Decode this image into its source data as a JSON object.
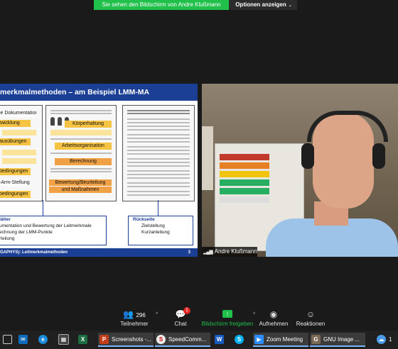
{
  "share_banner": {
    "message": "Sie sehen den Bildschirm von Andre Klußmann",
    "options_label": "Optionen anzeigen",
    "options_chevron": "⌄"
  },
  "slide": {
    "title": "merkmalmethoden – am Beispiel LMM-MA",
    "labels": {
      "dokumentation": "ie Dokumentation",
      "entwicklung": "twicklung",
      "koerperhaltung": "Körperhaltung",
      "ausuebungen": "ausübungen",
      "arbeitsorganisation": "Arbeitsorganisation",
      "berechnung": "Berechnung",
      "bedingungen": "bedingungen",
      "arm_stellung": "-Arm-Stellung",
      "bewertung": "Bewertung/Beurteilung",
      "massnahmen": "und Maßnahmen",
      "bedingungen2": "bedingungen"
    },
    "left_box": {
      "heading": "lätter",
      "lines": [
        "umentation und Bewertung der Leitmerkmale",
        "echnung der LMM-Punkte",
        "rteilung"
      ]
    },
    "right_box": {
      "heading": "Rückseite",
      "lines": [
        "Zielstellung",
        "Kurzanleitung"
      ]
    },
    "footer_text": "GAPHYS): Leitmerkmalmethoden",
    "page_number": "3"
  },
  "video": {
    "participant_name": "Andre Klußmann"
  },
  "toolbar": {
    "participants_label": "Teilnehmer",
    "participants_count": "296",
    "chat_label": "Chat",
    "chat_badge": "1",
    "share_label": "Bildschirm freigeben",
    "record_label": "Aufnehmen",
    "reactions_label": "Reaktionen"
  },
  "taskbar": {
    "powerpoint_label": "Screenshots -...",
    "speedcomm_label": "SpeedComm...",
    "zoom_label": "Zoom Meeting",
    "gimp_label": "GNU Image ...",
    "tray_text": "1"
  },
  "colors": {
    "banner_green": "#20c04a",
    "slide_blue": "#1b3f94",
    "label_yellow": "#f6c343",
    "label_orange": "#f0a045",
    "badge_red": "#e02424"
  }
}
